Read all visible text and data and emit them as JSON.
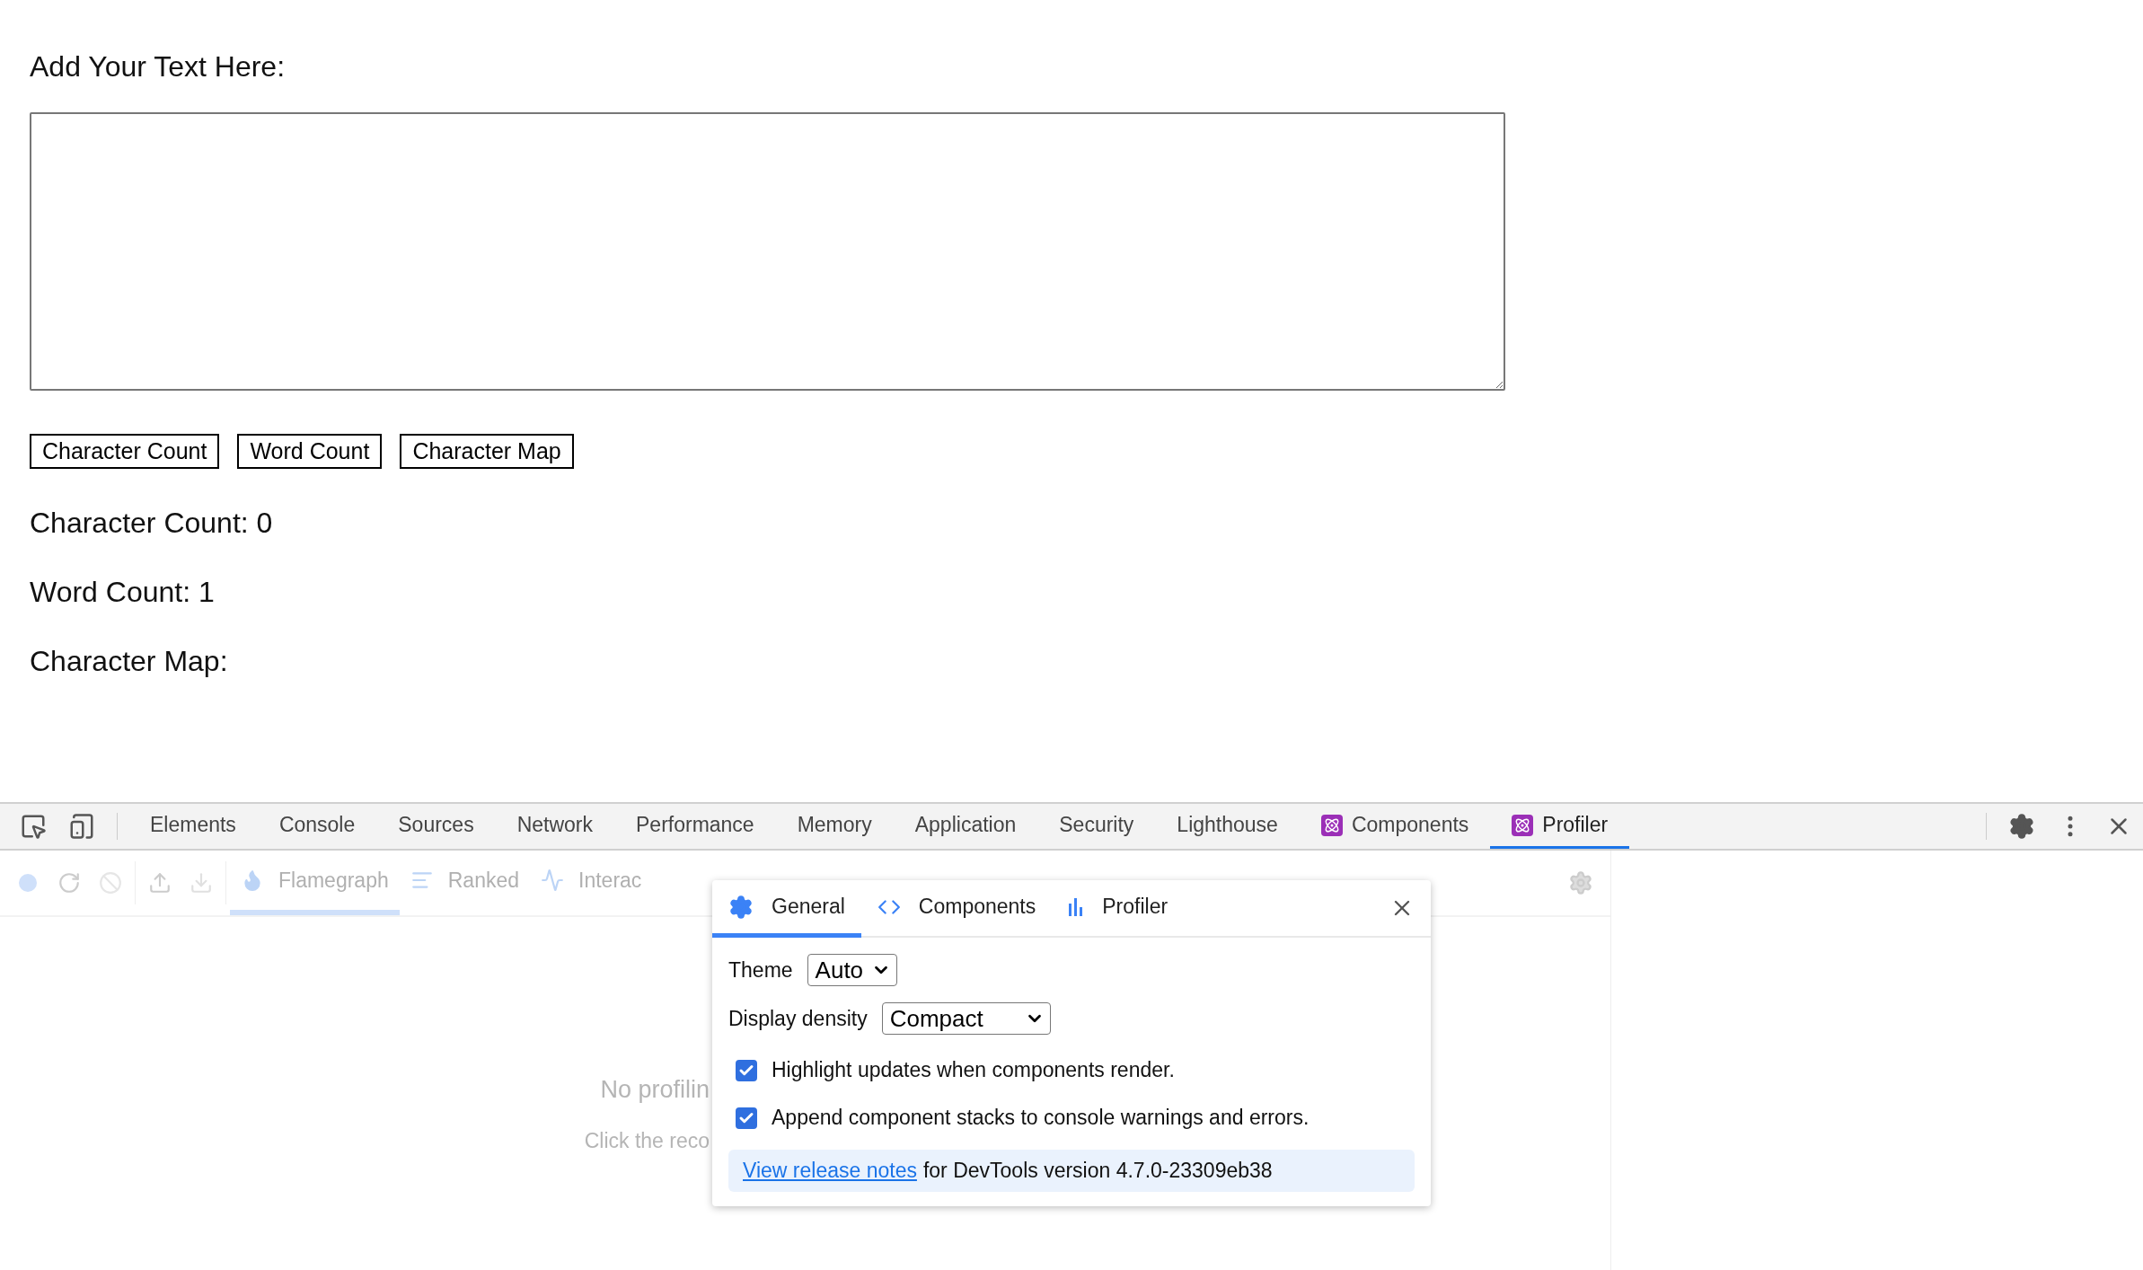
{
  "page": {
    "heading": "Add Your Text Here:",
    "buttons": [
      "Character Count",
      "Word Count",
      "Character Map"
    ],
    "results": [
      "Character Count: 0",
      "Word Count: 1",
      "Character Map:"
    ]
  },
  "devtools": {
    "tabs": [
      {
        "label": "Elements",
        "selected": false,
        "kind": "plain"
      },
      {
        "label": "Console",
        "selected": false,
        "kind": "plain"
      },
      {
        "label": "Sources",
        "selected": false,
        "kind": "plain"
      },
      {
        "label": "Network",
        "selected": false,
        "kind": "plain"
      },
      {
        "label": "Performance",
        "selected": false,
        "kind": "plain"
      },
      {
        "label": "Memory",
        "selected": false,
        "kind": "plain"
      },
      {
        "label": "Application",
        "selected": false,
        "kind": "plain"
      },
      {
        "label": "Security",
        "selected": false,
        "kind": "plain"
      },
      {
        "label": "Lighthouse",
        "selected": false,
        "kind": "plain"
      },
      {
        "label": "Components",
        "selected": false,
        "kind": "react"
      },
      {
        "label": "Profiler",
        "selected": true,
        "kind": "react"
      }
    ]
  },
  "profiler": {
    "tabs": [
      {
        "label": "Flamegraph",
        "selected": true,
        "kind": "flame"
      },
      {
        "label": "Ranked",
        "selected": false,
        "kind": "ranked"
      },
      {
        "label": "Interac",
        "selected": false,
        "kind": "interactions"
      }
    ],
    "empty_title": "No profilin",
    "empty_hint": "Click the reco"
  },
  "settings": {
    "tabs": [
      {
        "label": "General",
        "selected": true,
        "kind": "general"
      },
      {
        "label": "Components",
        "selected": false,
        "kind": "components"
      },
      {
        "label": "Profiler",
        "selected": false,
        "kind": "profiler"
      }
    ],
    "theme": {
      "label": "Theme",
      "value": "Auto"
    },
    "density": {
      "label": "Display density",
      "value": "Compact"
    },
    "options": [
      {
        "label": "Highlight updates when components render.",
        "checked": true
      },
      {
        "label": "Append component stacks to console warnings and errors.",
        "checked": true
      }
    ],
    "footer": {
      "link": "View release notes",
      "text": "for DevTools version 4.7.0-23309eb38"
    }
  }
}
